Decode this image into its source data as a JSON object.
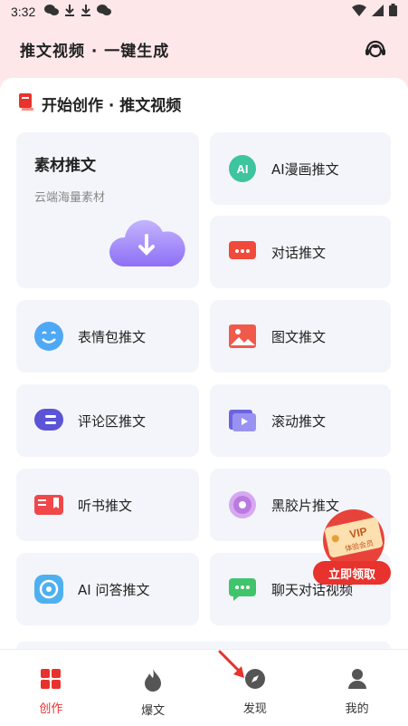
{
  "status_bar": {
    "time": "3:32"
  },
  "header": {
    "title": "推文视频 · 一键生成"
  },
  "section": {
    "title": "开始创作 · 推文视频"
  },
  "featured": {
    "label": "素材推文",
    "subtitle": "云端海量素材"
  },
  "cards": [
    {
      "label": "AI漫画推文"
    },
    {
      "label": "对话推文"
    },
    {
      "label": "表情包推文"
    },
    {
      "label": "图文推文"
    },
    {
      "label": "评论区推文"
    },
    {
      "label": "滚动推文"
    },
    {
      "label": "听书推文"
    },
    {
      "label": "黑胶片推文"
    },
    {
      "label": "AI 问答推文"
    },
    {
      "label": "聊天对话视频"
    }
  ],
  "vip": {
    "badge_text": "VIP",
    "badge_sub": "体验会员",
    "button": "立即领取"
  },
  "nav": [
    {
      "label": "创作"
    },
    {
      "label": "爆文"
    },
    {
      "label": "发现"
    },
    {
      "label": "我的"
    }
  ],
  "colors": {
    "accent": "#e8322d",
    "card_bg": "#f3f5fb",
    "header_bg": "#fde7e9"
  }
}
